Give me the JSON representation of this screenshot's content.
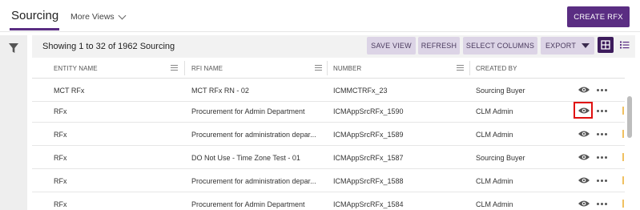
{
  "header": {
    "active_tab": "Sourcing",
    "more_views": "More Views",
    "create_button": "CREATE RFX"
  },
  "toolbar": {
    "showing_text": "Showing 1 to 32 of 1962 Sourcing",
    "save_view": "SAVE VIEW",
    "refresh": "REFRESH",
    "select_columns": "SELECT COLUMNS",
    "export": "EXPORT"
  },
  "table": {
    "columns": [
      "ENTITY NAME",
      "RFI NAME",
      "NUMBER",
      "CREATED BY"
    ],
    "rows": [
      {
        "entity": "MCT RFx",
        "rfi_name": "MCT RFx RN - 02",
        "number": "ICMMCTRFx_23",
        "created_by": "Sourcing Buyer"
      },
      {
        "entity": "RFx",
        "rfi_name": "Procurement for Admin Department",
        "number": "ICMAppSrcRFx_1590",
        "created_by": "CLM Admin"
      },
      {
        "entity": "RFx",
        "rfi_name": "Procurement for administration depar...",
        "number": "ICMAppSrcRFx_1589",
        "created_by": "CLM Admin"
      },
      {
        "entity": "RFx",
        "rfi_name": "DO Not Use - Time Zone Test - 01",
        "number": "ICMAppSrcRFx_1587",
        "created_by": "Sourcing Buyer"
      },
      {
        "entity": "RFx",
        "rfi_name": "Procurement for administration depar...",
        "number": "ICMAppSrcRFx_1588",
        "created_by": "CLM Admin"
      },
      {
        "entity": "RFx",
        "rfi_name": "Procurement for Admin Department",
        "number": "ICMAppSrcRFx_1584",
        "created_by": "CLM Admin"
      }
    ]
  },
  "icons": {
    "filter": "filter-icon",
    "view": "eye-icon",
    "more": "more-dots-icon",
    "grid_view": "grid-view-icon",
    "list_view": "list-view-icon"
  },
  "colors": {
    "brand": "#5a2d82",
    "button_bg": "#dcd4e6",
    "highlight": "#e01010"
  }
}
